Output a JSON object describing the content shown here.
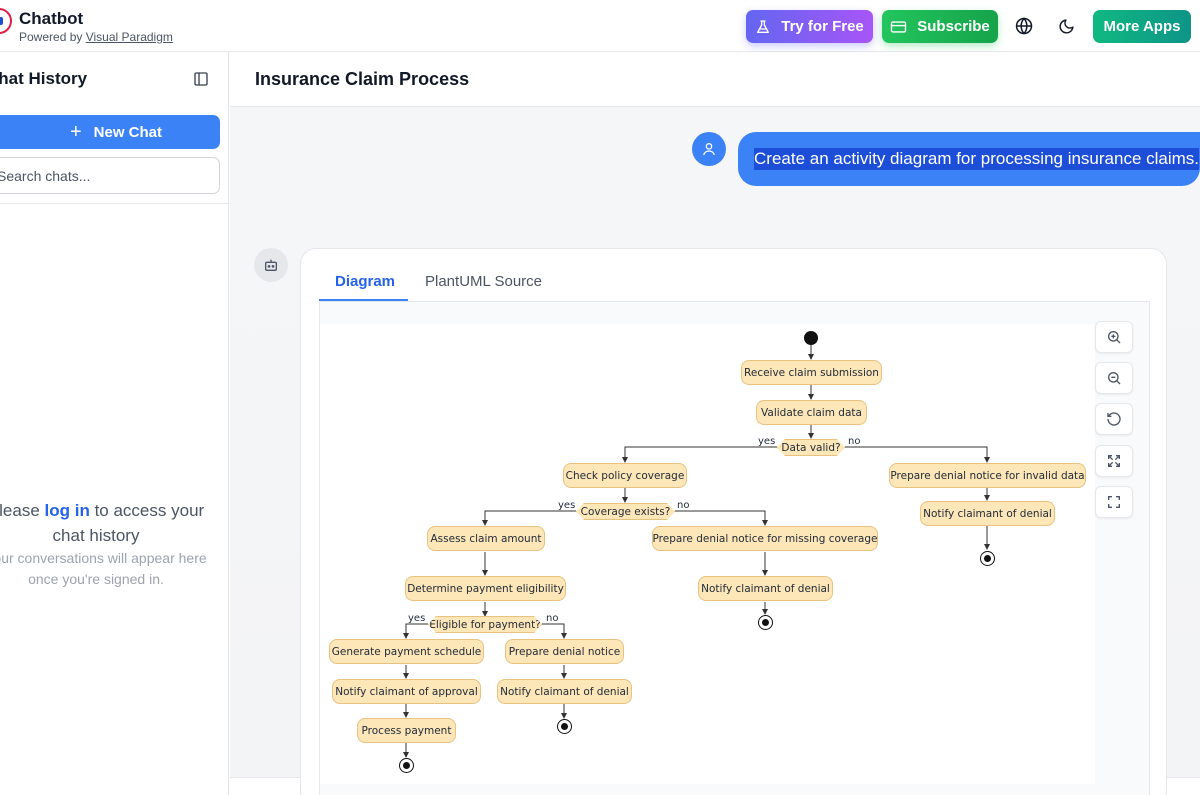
{
  "header": {
    "app_title": "Chatbot",
    "powered_prefix": "Powered by",
    "powered_link": "Visual Paradigm",
    "try_label": "Try for Free",
    "subscribe_label": "Subscribe",
    "more_apps_label": "More Apps"
  },
  "sidebar": {
    "title": "Chat History",
    "new_chat_label": "New Chat",
    "search_placeholder": "Search chats...",
    "login_prefix": "Please",
    "login_link": "log in",
    "login_suffix": "to access your chat history",
    "login_sub": "Your conversations will appear here once you're signed in."
  },
  "main": {
    "title": "Insurance Claim Process",
    "user_message": "Create an activity diagram for processing insurance claims.",
    "tabs": [
      {
        "label": "Diagram",
        "active": true
      },
      {
        "label": "PlantUML Source",
        "active": false
      }
    ]
  },
  "diagram": {
    "actions": {
      "receive": "Receive claim submission",
      "validate": "Validate claim data",
      "check_policy": "Check policy coverage",
      "prep_invalid": "Prepare denial notice for invalid data",
      "notify_denial_1": "Notify claimant of denial",
      "assess": "Assess claim amount",
      "prep_missing": "Prepare denial notice for missing coverage",
      "notify_denial_2": "Notify claimant of denial",
      "determine": "Determine payment eligibility",
      "gen_schedule": "Generate payment schedule",
      "prep_denial": "Prepare denial notice",
      "notify_approval": "Notify claimant of approval",
      "notify_denial_3": "Notify claimant of denial",
      "process_payment": "Process payment"
    },
    "decisions": {
      "data_valid": "Data valid?",
      "coverage_exists": "Coverage exists?",
      "eligible": "Eligible for payment?"
    },
    "branch_labels": {
      "yes": "yes",
      "no": "no"
    }
  }
}
